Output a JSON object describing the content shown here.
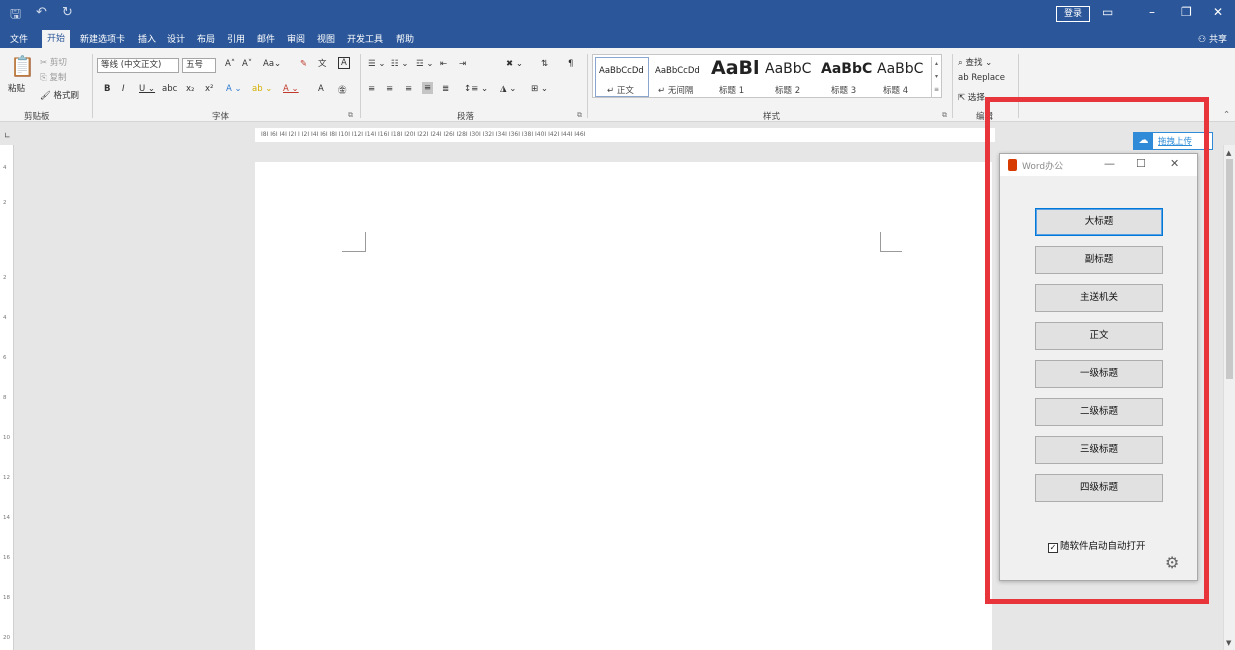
{
  "titlebar": {
    "login": "登录"
  },
  "tabs": [
    "文件",
    "开始",
    "新建选项卡",
    "插入",
    "设计",
    "布局",
    "引用",
    "邮件",
    "审阅",
    "视图",
    "开发工具",
    "帮助"
  ],
  "share": "共享",
  "clipboard": {
    "paste": "粘贴",
    "cut": "剪切",
    "copy": "复制",
    "painter": "格式刷",
    "label": "剪贴板"
  },
  "font": {
    "name": "等线 (中文正文)",
    "size": "五号",
    "label": "字体"
  },
  "paragraph": {
    "label": "段落"
  },
  "styles": {
    "label": "样式",
    "items": [
      {
        "preview": "AaBbCcDd",
        "name": "↵ 正文"
      },
      {
        "preview": "AaBbCcDd",
        "name": "↵ 无间隔"
      },
      {
        "preview": "AaBl",
        "name": "标题 1"
      },
      {
        "preview": "AaBbC",
        "name": "标题 2"
      },
      {
        "preview": "AaBbC",
        "name": "标题 3"
      },
      {
        "preview": "AaBbC",
        "name": "标题 4"
      }
    ]
  },
  "editing": {
    "find": "查找",
    "replace": "Replace",
    "select": "选择",
    "label": "编辑"
  },
  "ruler": {
    "marks": "I8I  I6I  I4I  I2I  I  I2I  I4I  I6I  I8I  I10I  I12I  I14I  I16I  I18I  I20I  I22I  I24I  I26I  I28I  I30I  I32I  I34I  I36I  I38I  I40I  I42I  I44I  I46I"
  },
  "plugin": {
    "upload": "拖拽上传",
    "title": "Word办公",
    "buttons": [
      "大标题",
      "副标题",
      "主送机关",
      "正文",
      "一级标题",
      "二级标题",
      "三级标题",
      "四级标题"
    ],
    "autostart": "随软件启动自动打开",
    "autostart_checked": true
  },
  "colors": {
    "brand": "#2b579a",
    "highlight": "#e8353b"
  }
}
